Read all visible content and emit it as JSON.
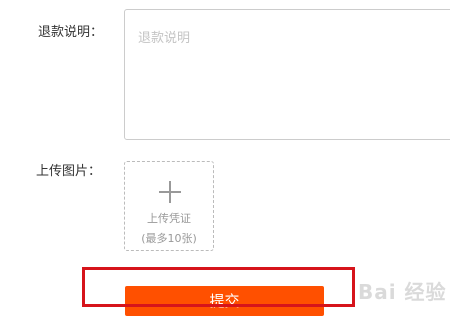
{
  "form": {
    "description": {
      "label": "退款说明：",
      "placeholder": "退款说明",
      "value": ""
    },
    "upload": {
      "label": "上传图片：",
      "button_title": "上传凭证",
      "button_limit": "(最多10张)",
      "icon": "plus-icon"
    },
    "submit": {
      "label": "提交"
    }
  },
  "watermark": {
    "text": "Bai 经验"
  },
  "colors": {
    "submit_background": "#ff5000",
    "highlight_border": "#d6141b",
    "label_text": "#333333",
    "placeholder_text": "#c4c4c4",
    "upload_text": "#999999"
  }
}
